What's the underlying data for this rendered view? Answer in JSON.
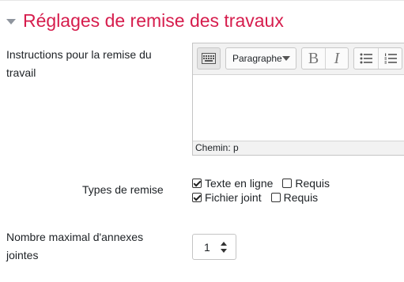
{
  "section": {
    "title": "Réglages de remise des travaux"
  },
  "instructions": {
    "label": "Instructions pour la remise du travail",
    "toolbar": {
      "paragraph_select": "Paragraphe",
      "bold": "B",
      "italic": "I"
    },
    "status_path": "Chemin: p"
  },
  "submission_types": {
    "label": "Types de remise",
    "options": [
      {
        "label": "Texte en ligne",
        "checked": true,
        "required_label": "Requis",
        "required_checked": false
      },
      {
        "label": "Fichier joint",
        "checked": true,
        "required_label": "Requis",
        "required_checked": false
      }
    ]
  },
  "max_files": {
    "label": "Nombre maximal d'annexes jointes",
    "value": "1"
  },
  "colors": {
    "accent": "#d61d4d"
  }
}
